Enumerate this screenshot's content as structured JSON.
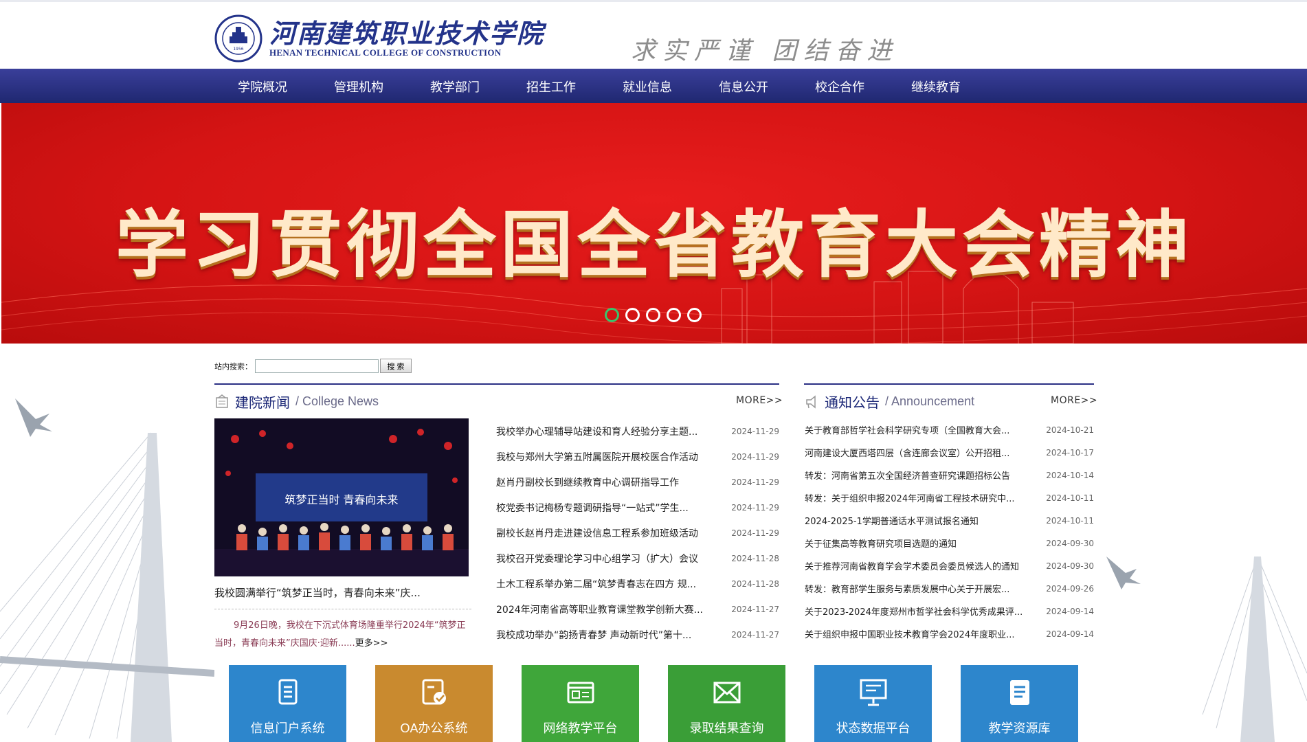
{
  "header": {
    "logo_cn": "河南建筑职业技术学院",
    "logo_en": "HENAN TECHNICAL COLLEGE OF CONSTRUCTION",
    "motto": "求实严谨 团结奋进",
    "seal_text": "1956"
  },
  "nav": {
    "items": [
      "学院概况",
      "管理机构",
      "教学部门",
      "招生工作",
      "就业信息",
      "信息公开",
      "校企合作",
      "继续教育"
    ]
  },
  "banner": {
    "title": "学习贯彻全国全省教育大会精神",
    "slide_count": 5,
    "active_slide": 1
  },
  "search": {
    "label": "站内搜索：",
    "value": "",
    "button": "搜 索"
  },
  "news": {
    "title": "建院新闻",
    "title_en": "/ College News",
    "more": "MORE>>",
    "photo_banner_text": "筑梦正当时 青春向未来",
    "featured_caption": "我校圆满举行“筑梦正当时，青春向未来”庆...",
    "featured_summary": "9月26日晚，我校在下沉式体育场隆重举行2024年“筑梦正当时，青春向未来”庆国庆·迎新......",
    "featured_more": "更多>>",
    "items": [
      {
        "title": "我校举办心理辅导站建设和育人经验分享主题...",
        "date": "2024-11-29"
      },
      {
        "title": "我校与郑州大学第五附属医院开展校医合作活动",
        "date": "2024-11-29"
      },
      {
        "title": "赵肖丹副校长到继续教育中心调研指导工作",
        "date": "2024-11-29"
      },
      {
        "title": "校党委书记梅杨专题调研指导“一站式”学生...",
        "date": "2024-11-29"
      },
      {
        "title": "副校长赵肖丹走进建设信息工程系参加班级活动",
        "date": "2024-11-29"
      },
      {
        "title": "我校召开党委理论学习中心组学习（扩大）会议",
        "date": "2024-11-28"
      },
      {
        "title": "土木工程系举办第二届“筑梦青春志在四方 规...",
        "date": "2024-11-28"
      },
      {
        "title": "2024年河南省高等职业教育课堂教学创新大赛...",
        "date": "2024-11-27"
      },
      {
        "title": "我校成功举办“韵扬青春梦 声动新时代”第十...",
        "date": "2024-11-27"
      }
    ]
  },
  "notice": {
    "title": "通知公告",
    "title_en": "/ Announcement",
    "more": "MORE>>",
    "items": [
      {
        "title": "关于教育部哲学社会科学研究专项（全国教育大会...",
        "date": "2024-10-21"
      },
      {
        "title": "河南建设大厦西塔四层（含连廊会议室）公开招租...",
        "date": "2024-10-17"
      },
      {
        "title": "转发：河南省第五次全国经济普查研究课题招标公告",
        "date": "2024-10-14"
      },
      {
        "title": "转发：关于组织申报2024年河南省工程技术研究中...",
        "date": "2024-10-11"
      },
      {
        "title": "2024-2025-1学期普通话水平测试报名通知",
        "date": "2024-10-11"
      },
      {
        "title": "关于征集高等教育研究项目选题的通知",
        "date": "2024-09-30"
      },
      {
        "title": "关于推荐河南省教育学会学术委员会委员候选人的通知",
        "date": "2024-09-30"
      },
      {
        "title": "转发：教育部学生服务与素质发展中心关于开展宏...",
        "date": "2024-09-26"
      },
      {
        "title": "关于2023-2024年度郑州市哲学社会科学优秀成果评...",
        "date": "2024-09-14"
      },
      {
        "title": "关于组织申报中国职业技术教育学会2024年度职业...",
        "date": "2024-09-14"
      }
    ]
  },
  "tiles": [
    {
      "label": "信息门户系统",
      "color": "#2d86cc",
      "icon": "document-list-icon"
    },
    {
      "label": "OA办公系统",
      "color": "#c98a2f",
      "icon": "approval-doc-icon"
    },
    {
      "label": "网络教学平台",
      "color": "#3fa63a",
      "icon": "browser-window-icon"
    },
    {
      "label": "录取结果查询",
      "color": "#3a9e37",
      "icon": "envelope-icon"
    },
    {
      "label": "状态数据平台",
      "color": "#2d86cc",
      "icon": "presentation-board-icon"
    },
    {
      "label": "教学资源库",
      "color": "#2d86cc",
      "icon": "document-icon"
    }
  ]
}
